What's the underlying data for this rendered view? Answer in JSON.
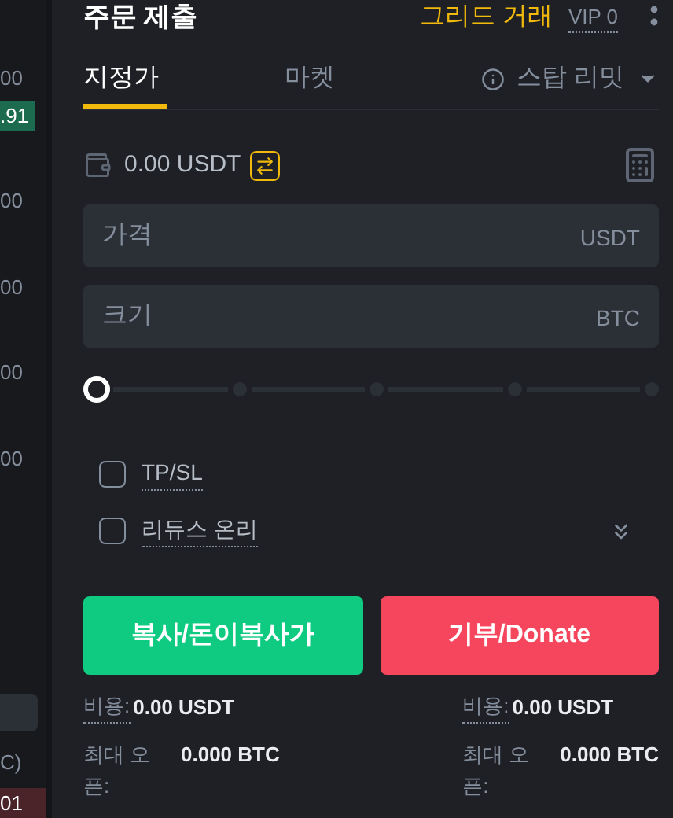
{
  "order_book": {
    "prices": [
      {
        "text": "00"
      },
      {
        "text": ".91",
        "color": "#1d6b4f"
      },
      {
        "text": "00"
      },
      {
        "text": "00"
      },
      {
        "text": "00"
      },
      {
        "text": "00"
      }
    ],
    "unit": "C)",
    "last": {
      "text": "01",
      "color": "#4a2428"
    }
  },
  "header": {
    "title": "주문 제출",
    "grid_link": "그리드 거래",
    "vip": "VIP 0"
  },
  "tabs": [
    {
      "label": "지정가",
      "selected": true,
      "kind": "plain"
    },
    {
      "label": "마켓",
      "selected": false,
      "kind": "plain"
    },
    {
      "label": "스탑 리밋",
      "selected": false,
      "kind": "dropdown"
    }
  ],
  "balance": "0.00 USDT",
  "fields": [
    {
      "placeholder": "가격",
      "unit": "USDT"
    },
    {
      "placeholder": "크기",
      "unit": "BTC"
    }
  ],
  "slider": {
    "level": 0
  },
  "options": [
    {
      "label": "TP/SL",
      "checked": false
    },
    {
      "label": "리듀스 온리",
      "checked": false
    }
  ],
  "buttons": [
    {
      "label": "복사/돈이복사가",
      "kind": "buy"
    },
    {
      "label": "기부/Donate",
      "kind": "sell"
    }
  ],
  "sides": [
    {
      "fee_label": "비용:",
      "fee": "0.00 USDT",
      "max_label": "최대 오픈:",
      "max": "0.000 BTC"
    },
    {
      "fee_label": "비용:",
      "fee": "0.00 USDT",
      "max_label": "최대 오픈:",
      "max": "0.000 BTC"
    }
  ]
}
